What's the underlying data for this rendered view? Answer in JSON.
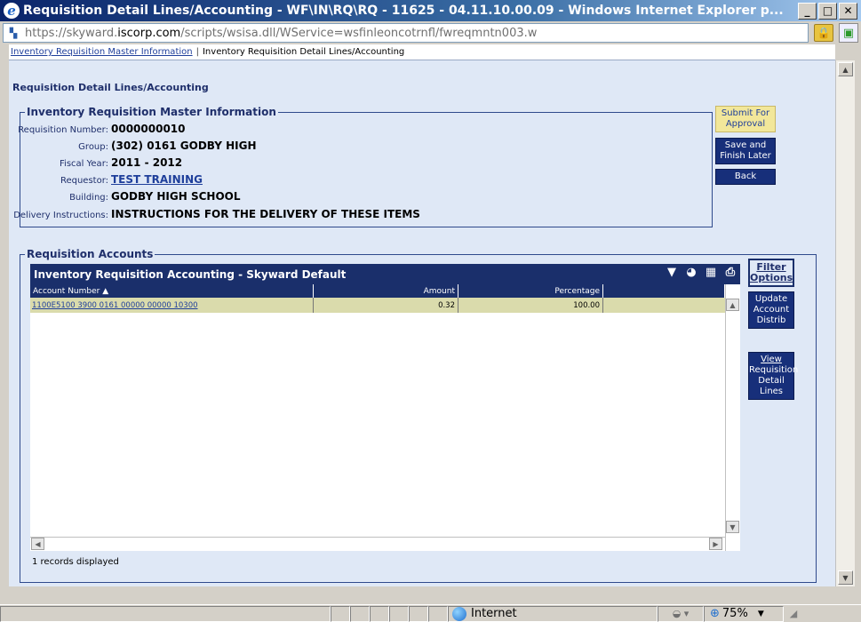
{
  "window": {
    "title": "Requisition Detail Lines/Accounting - WF\\IN\\RQ\\RQ - 11625 - 04.11.10.00.09 - Windows Internet Explorer p...",
    "minimize": "_",
    "maximize": "□",
    "close": "✕"
  },
  "address": {
    "prefix": "https://skyward.",
    "host": "iscorp.com",
    "path": "/scripts/wsisa.dll/WService=wsfinleoncotrnfl/fwreqmntn003.w"
  },
  "breadcrumb": {
    "link": "Inventory Requisition Master Information",
    "separator": "|",
    "current": "Inventory Requisition Detail Lines/Accounting"
  },
  "page": {
    "title": "Requisition Detail Lines/Accounting"
  },
  "master": {
    "legend": "Inventory Requisition Master Information",
    "fields": [
      {
        "label": "Requisition Number:",
        "value": "0000000010"
      },
      {
        "label": "Group:",
        "value": "(302) 0161 GODBY HIGH"
      },
      {
        "label": "Fiscal Year:",
        "value": "2011 - 2012"
      },
      {
        "label": "Requestor:",
        "value": "TEST TRAINING"
      },
      {
        "label": "Building:",
        "value": "GODBY HIGH SCHOOL"
      },
      {
        "label": "Delivery Instructions:",
        "value": "INSTRUCTIONS FOR THE DELIVERY OF THESE ITEMS"
      }
    ]
  },
  "actions": {
    "submit_1": "Submit For",
    "submit_2": "Approval",
    "save_1": "Save and",
    "save_2": "Finish Later",
    "back": "Back"
  },
  "accounts": {
    "legend": "Requisition Accounts",
    "grid_title": "Inventory Requisition Accounting - Skyward Default",
    "columns": {
      "account": "Account Number ▲",
      "amount": "Amount",
      "percentage": "Percentage"
    },
    "rows": [
      {
        "account": "1100E5100 3900 0161 00000 00000 10300",
        "amount": "0.32",
        "percentage": "100.00"
      }
    ],
    "records": "1 records displayed"
  },
  "side_buttons": {
    "filter_1": "Filter",
    "filter_2": "Options",
    "update_1": "Update",
    "update_2": "Account",
    "update_3": "Distrib",
    "view_1": "View",
    "view_2": "Requisition",
    "view_3": "Detail Lines"
  },
  "status": {
    "zone": "Internet",
    "zoom": "75%"
  }
}
